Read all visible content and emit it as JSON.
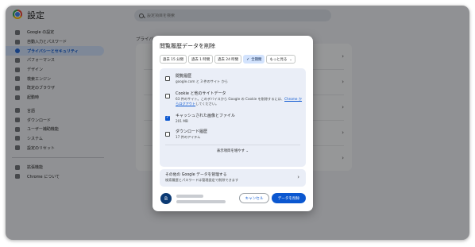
{
  "app": {
    "title": "設定"
  },
  "search": {
    "placeholder": "設定項目を検索"
  },
  "sidebar": {
    "items": [
      {
        "label": "Google の設定"
      },
      {
        "label": "自動入力とパスワード"
      },
      {
        "label": "プライバシーとセキュリティ",
        "active": true
      },
      {
        "label": "パフォーマンス"
      },
      {
        "label": "デザイン"
      },
      {
        "label": "検索エンジン"
      },
      {
        "label": "既定のブラウザ"
      },
      {
        "label": "起動時"
      },
      {
        "label": "言語"
      },
      {
        "label": "ダウンロード"
      },
      {
        "label": "ユーザー補助機能"
      },
      {
        "label": "システム"
      },
      {
        "label": "設定のリセット"
      },
      {
        "label": "拡張機能"
      },
      {
        "label": "Chrome について"
      }
    ]
  },
  "main": {
    "heading": "プライバシーとセキュリティ"
  },
  "dialog": {
    "title": "閲覧履歴データを削除",
    "time_ranges": [
      "過去 15 分間",
      "過去 1 時間",
      "過去 24 時間",
      "全期間",
      "もっと見る"
    ],
    "selected_range": "全期間",
    "options": [
      {
        "title": "閲覧履歴",
        "desc": "google.com と 3 件のサイト から",
        "checked": false
      },
      {
        "title": "Cookie と他のサイトデータ",
        "desc": "63 件のサイト。このデバイスから Google の Cookie を削除するには、",
        "link": "Chrome からログアウト",
        "desc_tail": "してください。",
        "checked": false
      },
      {
        "title": "キャッシュされた画像とファイル",
        "desc": "201 MB",
        "checked": true
      },
      {
        "title": "ダウンロード履歴",
        "desc": "17 件のアイテム",
        "checked": false
      }
    ],
    "show_more_label": "表示項目を増やす",
    "other_data": {
      "title": "その他の Google データを管理する",
      "desc": "検索履歴とパスワードは管理設定で削除できます"
    },
    "account": {
      "avatar_letter": "B"
    },
    "cancel_label": "キャンセル",
    "delete_label": "データを削除"
  },
  "colors": {
    "accent": "#0b57d0",
    "selected_chip": "#d3e3fd",
    "card": "#eaeef7"
  }
}
